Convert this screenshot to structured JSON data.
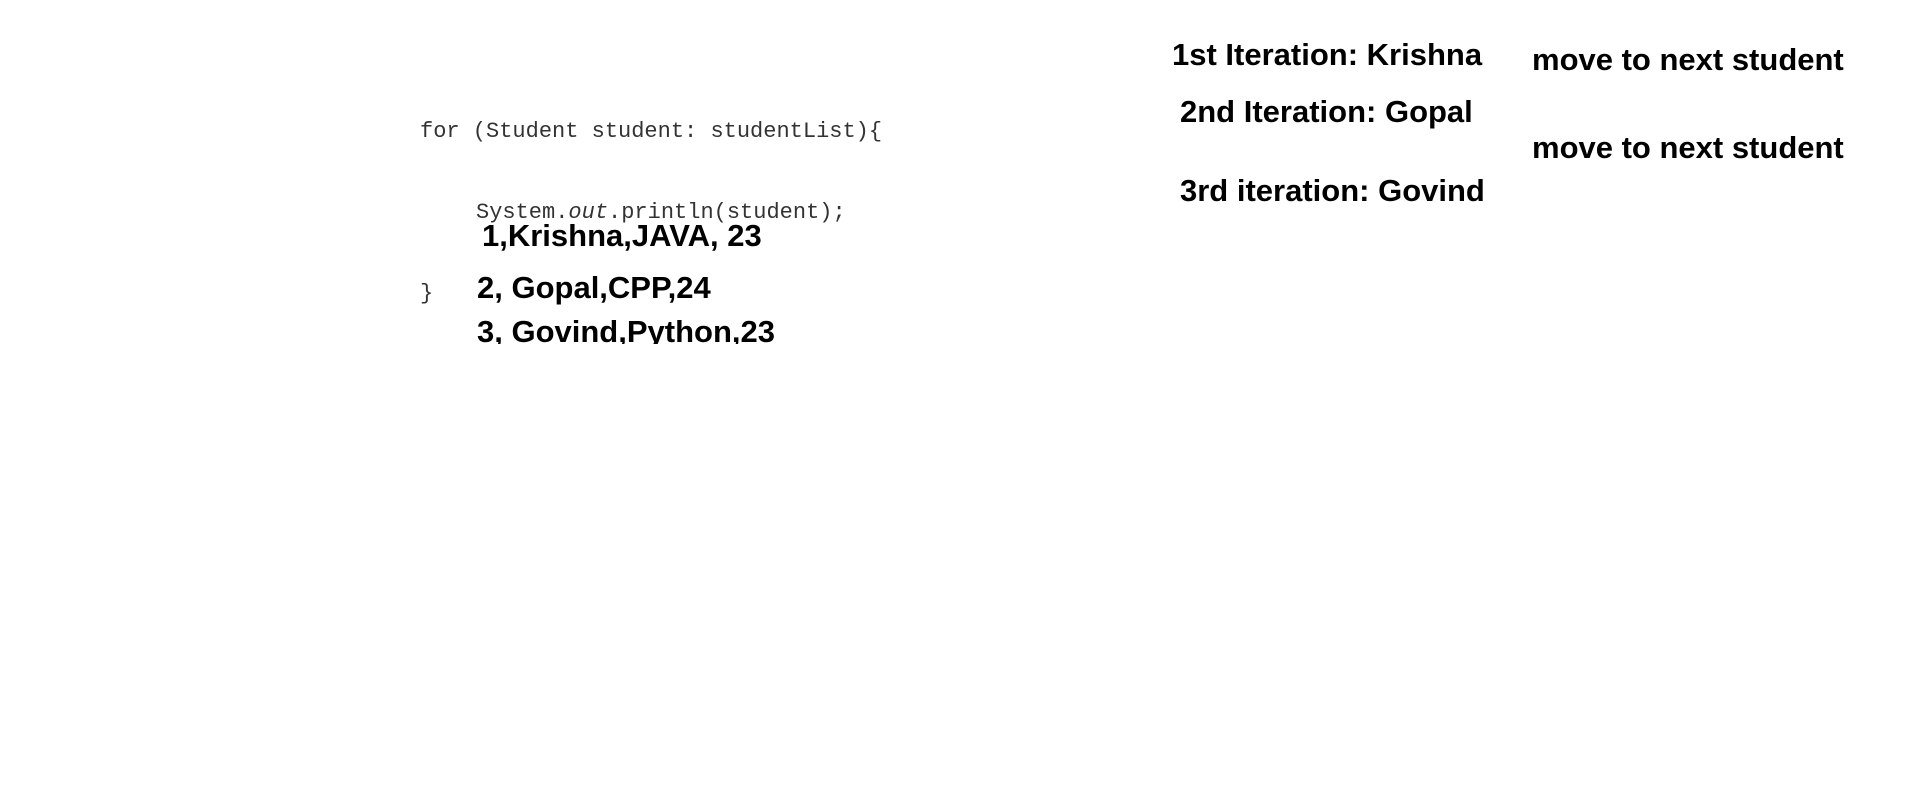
{
  "code": {
    "line1": "for (Student student: studentList){",
    "line2_prefix": "System.",
    "line2_italic": "out",
    "line2_suffix": ".println(student);",
    "line3": "}"
  },
  "student_rows": [
    "1,Krishna,JAVA, 23",
    "2, Gopal,CPP,24",
    "3, Govind,Python,23"
  ],
  "iterations": [
    "1st Iteration: Krishna",
    "2nd Iteration: Gopal",
    "3rd iteration: Govind"
  ],
  "move_labels": [
    "move to next student",
    "move to next student"
  ]
}
